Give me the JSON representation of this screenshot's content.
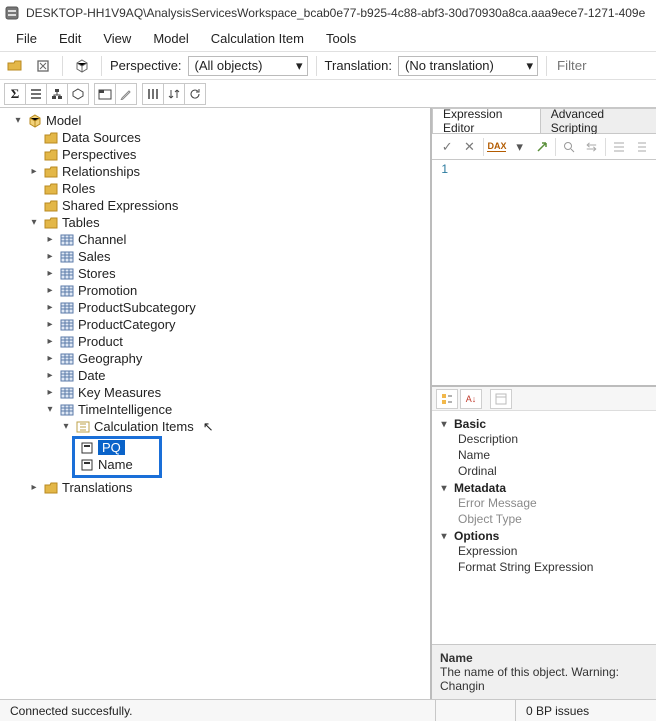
{
  "title": "DESKTOP-HH1V9AQ\\AnalysisServicesWorkspace_bcab0e77-b925-4c88-abf3-30d70930a8ca.aaa9ece7-1271-409e",
  "menu": {
    "file": "File",
    "edit": "Edit",
    "view": "View",
    "model": "Model",
    "calcitem": "Calculation Item",
    "tools": "Tools"
  },
  "toolbar": {
    "perspective_label": "Perspective:",
    "perspective_value": "(All objects)",
    "translation_label": "Translation:",
    "translation_value": "(No translation)",
    "filter_placeholder": "Filter"
  },
  "tree": {
    "root": "Model",
    "data_sources": "Data Sources",
    "perspectives": "Perspectives",
    "relationships": "Relationships",
    "roles": "Roles",
    "shared_expressions": "Shared Expressions",
    "tables": "Tables",
    "translations": "Translations",
    "table_list": [
      "Channel",
      "Sales",
      "Stores",
      "Promotion",
      "ProductSubcategory",
      "ProductCategory",
      "Product",
      "Geography",
      "Date",
      "Key Measures",
      "TimeIntelligence"
    ],
    "calc_items_label": "Calculation Items",
    "calc_items": {
      "pq": "PQ",
      "name": "Name"
    }
  },
  "right": {
    "tab_editor": "Expression Editor",
    "tab_scripting": "Advanced Scripting",
    "line_no": "1"
  },
  "props": {
    "cat_basic": "Basic",
    "cat_meta": "Metadata",
    "cat_options": "Options",
    "basic": [
      "Description",
      "Name",
      "Ordinal"
    ],
    "meta": [
      "Error Message",
      "Object Type"
    ],
    "options": [
      "Expression",
      "Format String Expression"
    ],
    "help_title": "Name",
    "help_text": "The name of this object. Warning: Changin"
  },
  "status": {
    "connected": "Connected succesfully.",
    "bp": "0 BP issues"
  }
}
